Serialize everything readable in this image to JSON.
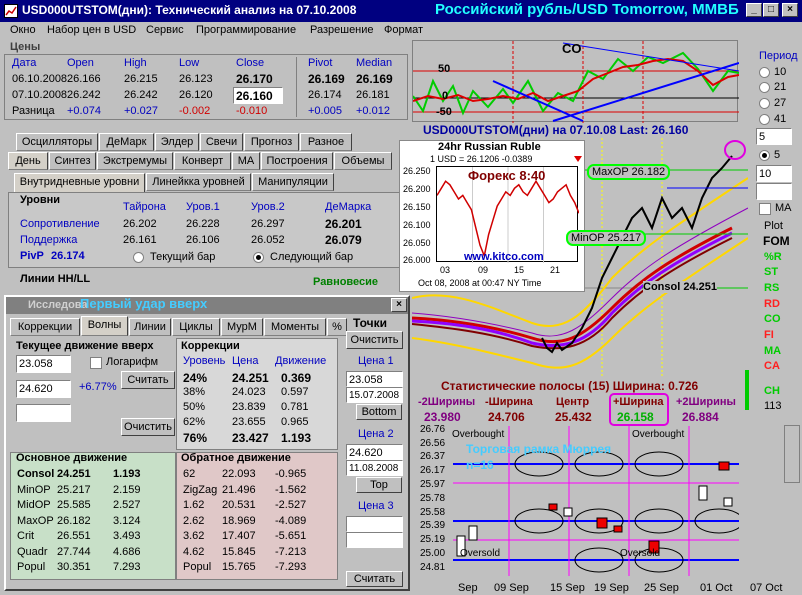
{
  "window": {
    "title": "USD000UTSTOM(дни): Технический анализ на 07.10.2008",
    "header_right": "Российский рубль/USD Tomorrow, ММВБ"
  },
  "menu": [
    "Окно",
    "Набор цен в USD",
    "Сервис",
    "Программирование",
    "Разрешение",
    "Формат"
  ],
  "prices": {
    "section_label": "Цены",
    "headers": [
      "Дата",
      "Open",
      "High",
      "Low",
      "Close",
      "Pivot",
      "Median"
    ],
    "rows": [
      [
        "06.10.2008",
        "26.166",
        "26.215",
        "26.123",
        "26.170",
        "26.169",
        "26.169"
      ],
      [
        "07.10.2008",
        "26.242",
        "26.242",
        "26.120",
        "26.160",
        "26.174",
        "26.181"
      ]
    ],
    "diff_label": "Разница",
    "diff": [
      "+0.074",
      "+0.027",
      "-0.002",
      "-0.010",
      "+0.005",
      "+0.012"
    ]
  },
  "tabs_row1": [
    "Осцилляторы",
    "ДеМарк",
    "Элдер",
    "Свечи",
    "Прогноз",
    "Разное"
  ],
  "tabs_row2": [
    "День",
    "Синтез",
    "Экстремумы",
    "Конверт",
    "МА",
    "Построения",
    "Объемы"
  ],
  "tabs_row3": [
    "Внутридневные уровни",
    "Линейкка уровней",
    "Манипуляции"
  ],
  "levels": {
    "title": "Уровни",
    "headers": [
      "Тайрона",
      "Уров.1",
      "Уров.2",
      "ДеМарка"
    ],
    "rows": [
      {
        "label": "Сопротивление",
        "values": [
          "26.202",
          "26.228",
          "26.297",
          "26.201"
        ]
      },
      {
        "label": "Поддержка",
        "values": [
          "26.161",
          "26.106",
          "26.052",
          "26.079"
        ]
      }
    ],
    "pivp_label": "PivP",
    "pivp": "26.174",
    "radio_current": "Текущий бар",
    "radio_next": "Следующий бар"
  },
  "hhll": {
    "label": "Линии HH/LL",
    "equilibrium": "Равновесие"
  },
  "research": {
    "title_overlay": "Первый удар вверх",
    "title_prefix": "Исследова",
    "tabs": [
      "Коррекции",
      "Волны",
      "Линии",
      "Циклы",
      "МурМ",
      "Моменты",
      "%"
    ],
    "current_move": {
      "title": "Текущее движение вверх",
      "value1": "23.058",
      "value2": "24.620",
      "pct": "+6.77%",
      "log_label": "Логарифм",
      "calc": "Считать",
      "clear": "Очистить"
    },
    "corrections": {
      "title": "Коррекции",
      "headers": [
        "Уровень",
        "Цена",
        "Движение"
      ],
      "rows": [
        [
          "24%",
          "24.251",
          "0.369"
        ],
        [
          "38%",
          "24.023",
          "0.597"
        ],
        [
          "50%",
          "23.839",
          "0.781"
        ],
        [
          "62%",
          "23.655",
          "0.965"
        ],
        [
          "76%",
          "23.427",
          "1.193"
        ]
      ]
    },
    "main_move": {
      "title": "Основное движение",
      "rows": [
        [
          "Consol",
          "24.251",
          "1.193"
        ],
        [
          "MinOP",
          "25.217",
          "2.159"
        ],
        [
          "MidOP",
          "25.585",
          "2.527"
        ],
        [
          "MaxOP",
          "26.182",
          "3.124"
        ],
        [
          "Crit",
          "26.551",
          "3.493"
        ],
        [
          "Quadr",
          "27.744",
          "4.686"
        ],
        [
          "Popul",
          "30.351",
          "7.293"
        ]
      ]
    },
    "reverse_move": {
      "title": "Обратное движение",
      "rows": [
        [
          "62",
          "22.093",
          "-0.965"
        ],
        [
          "ZigZag",
          "21.496",
          "-1.562"
        ],
        [
          "1.62",
          "20.531",
          "-2.527"
        ],
        [
          "2.62",
          "18.969",
          "-4.089"
        ],
        [
          "3.62",
          "17.407",
          "-5.651"
        ],
        [
          "4.62",
          "15.845",
          "-7.213"
        ],
        [
          "Popul",
          "15.765",
          "-7.293"
        ]
      ]
    },
    "points": {
      "title": "Точки",
      "clear": "Очистить",
      "price1_label": "Цена 1",
      "price1": "23.058",
      "date1": "15.07.2008",
      "bottom": "Bottom",
      "price2_label": "Цена 2",
      "price2": "24.620",
      "date2": "11.08.2008",
      "top": "Top",
      "price3_label": "Цена 3",
      "calc": "Считать"
    }
  },
  "chart": {
    "status": "USD000UTSTOM(дни) на 07.10.08   Last: 26.160",
    "osc_ticks": [
      "50",
      "0",
      "-50"
    ],
    "osc_label": "CO",
    "labels": {
      "maxop": "MaxOP 26.182",
      "minop": "MinOP  25.217",
      "consol": "Consol 24.251"
    },
    "stat_bands": "Статистические полосы (15)  Ширина: 0.726",
    "bands_headers": [
      "-2Ширины",
      "-Ширина",
      "Центр",
      "+Ширина",
      "+2Ширины"
    ],
    "bands_values": [
      "23.980",
      "24.706",
      "25.432",
      "26.158",
      "26.884"
    ],
    "murrey_title": "Торговая рамка Мюррея",
    "murrey_n": "n=16",
    "overbought": "Overbought",
    "oversold": "Oversold",
    "murrey_ticks": [
      "26.76",
      "26.56",
      "26.37",
      "26.17",
      "25.97",
      "25.78",
      "25.58",
      "25.39",
      "25.19",
      "25.00",
      "24.81"
    ],
    "date_ticks": [
      "Sep",
      "09 Sep",
      "15 Sep",
      "19 Sep",
      "25 Sep",
      "01 Oct",
      "07 Oct"
    ]
  },
  "kitco": {
    "title": "24hr Russian Ruble",
    "subtitle": "1 USD = 26.1206  -0.0389",
    "forex": "Форекс 8:40",
    "url": "www.kitco.com",
    "footer": "Oct 08, 2008 at 00:47 NY Time",
    "y_ticks": [
      "26.250",
      "26.200",
      "26.150",
      "26.100",
      "26.050",
      "26.000"
    ],
    "x_ticks": [
      "03",
      "09",
      "15",
      "21"
    ]
  },
  "side": {
    "period_label": "Период",
    "periods": [
      "10",
      "21",
      "27",
      "41"
    ],
    "period_value": "5",
    "radio5": "5",
    "value10": "10",
    "ma": "MA",
    "plot": "Plot",
    "fom": "FOM",
    "items": [
      "%R",
      "ST",
      "RS",
      "RD",
      "CO",
      "FI",
      "MA",
      "CA"
    ],
    "ch": "CH",
    "num": "113"
  },
  "colors": {
    "title_bg": "#000080",
    "chart_bg": "#c0c0c0",
    "murrey_bg": "#1a1a2e"
  },
  "kitco_chart_data": {
    "type": "line",
    "x_ticks": [
      "03",
      "09",
      "15",
      "21"
    ],
    "y_range": [
      26.0,
      26.27
    ]
  }
}
